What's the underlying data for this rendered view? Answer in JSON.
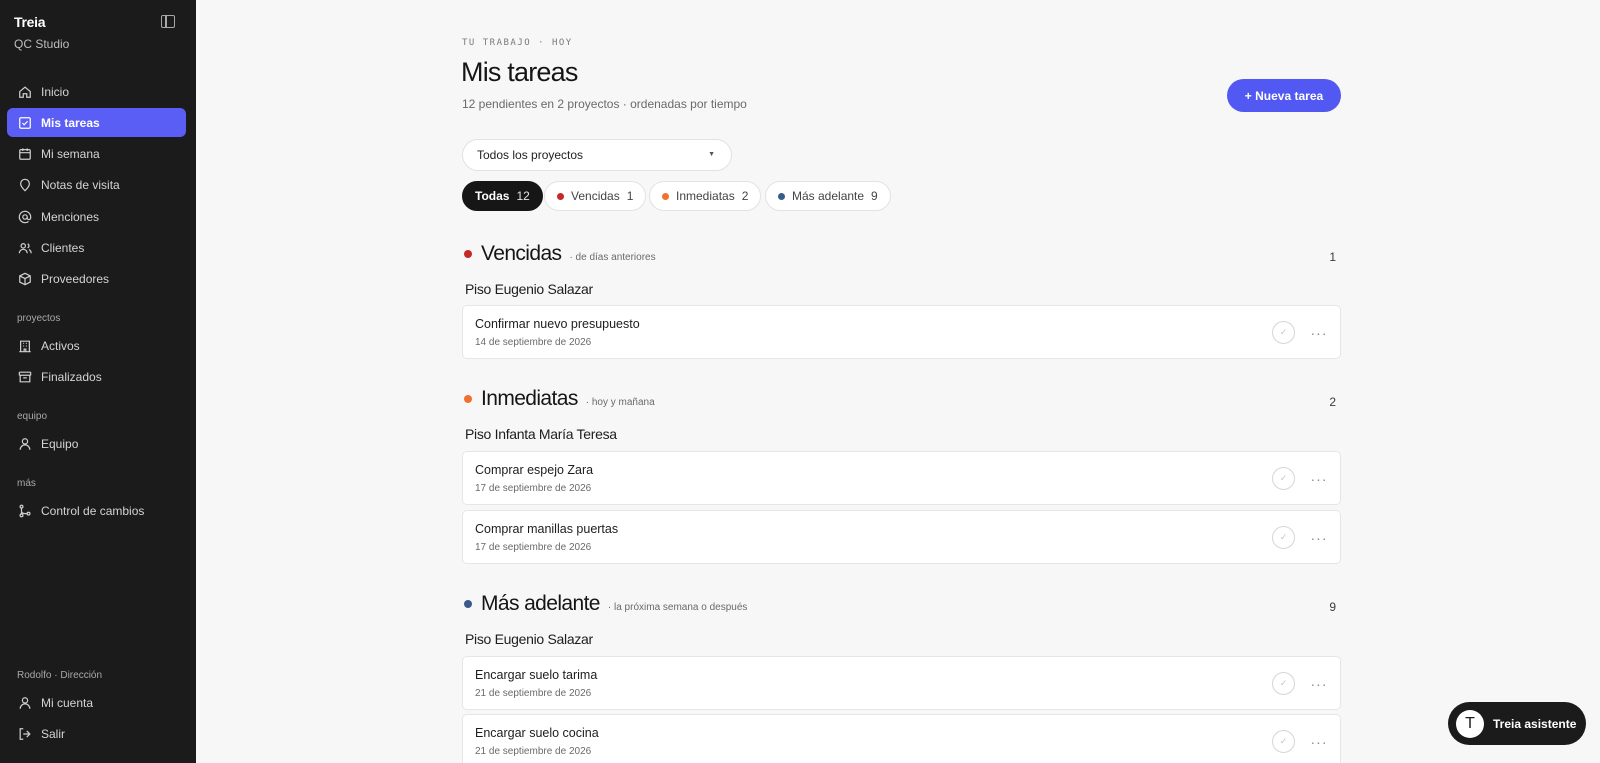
{
  "sidebar": {
    "brand": "Treia",
    "workspace": "QC Studio",
    "nav": [
      {
        "label": "Inicio",
        "icon": "home-icon"
      },
      {
        "label": "Mis tareas",
        "icon": "checkbox-icon",
        "active": true
      },
      {
        "label": "Mi semana",
        "icon": "calendar-icon"
      },
      {
        "label": "Notas de visita",
        "icon": "location-pin-icon"
      },
      {
        "label": "Menciones",
        "icon": "at-icon"
      },
      {
        "label": "Clientes",
        "icon": "users-icon"
      },
      {
        "label": "Proveedores",
        "icon": "box-icon"
      }
    ],
    "sections": {
      "proyectos": "proyectos",
      "equipo": "equipo",
      "mas": "más",
      "user": "Rodolfo · Dirección"
    },
    "proyectos_items": [
      {
        "label": "Activos",
        "icon": "building-icon"
      },
      {
        "label": "Finalizados",
        "icon": "archive-icon"
      }
    ],
    "equipo_items": [
      {
        "label": "Equipo",
        "icon": "user-icon"
      }
    ],
    "mas_items": [
      {
        "label": "Control de cambios",
        "icon": "git-branch-icon"
      }
    ],
    "account_items": [
      {
        "label": "Mi cuenta",
        "icon": "user-icon"
      },
      {
        "label": "Salir",
        "icon": "logout-icon"
      }
    ]
  },
  "header": {
    "eyebrow": "TU TRABAJO · HOY",
    "title": "Mis tareas",
    "subtitle": "12 pendientes en 2 proyectos · ordenadas por tiempo",
    "new_button": "+ Nueva tarea"
  },
  "filter": {
    "project_select": "Todos los proyectos",
    "chips": [
      {
        "label": "Todas",
        "count": "12",
        "active": true
      },
      {
        "label": "Vencidas",
        "count": "1",
        "color": "#c62828"
      },
      {
        "label": "Inmediatas",
        "count": "2",
        "color": "#f07030"
      },
      {
        "label": "Más adelante",
        "count": "9",
        "color": "#3a5a8c"
      }
    ]
  },
  "groups": [
    {
      "title": "Vencidas",
      "subtitle": "· de días anteriores",
      "count": "1",
      "color": "#c62828",
      "project": "Piso Eugenio Salazar",
      "tasks": [
        {
          "name": "Confirmar nuevo presupuesto",
          "date": "14 de septiembre de 2026"
        }
      ]
    },
    {
      "title": "Inmediatas",
      "subtitle": "· hoy y mañana",
      "count": "2",
      "color": "#f07030",
      "project": "Piso Infanta María Teresa",
      "tasks": [
        {
          "name": "Comprar espejo Zara",
          "date": "17 de septiembre de 2026"
        },
        {
          "name": "Comprar manillas puertas",
          "date": "17 de septiembre de 2026"
        }
      ]
    },
    {
      "title": "Más adelante",
      "subtitle": "· la próxima semana o después",
      "count": "9",
      "color": "#3a5a8c",
      "project": "Piso Eugenio Salazar",
      "tasks": [
        {
          "name": "Encargar suelo tarima",
          "date": "21 de septiembre de 2026"
        },
        {
          "name": "Encargar suelo cocina",
          "date": "21 de septiembre de 2026"
        }
      ]
    }
  ],
  "assistant": {
    "avatar_letter": "T",
    "label": "Treia asistente"
  }
}
